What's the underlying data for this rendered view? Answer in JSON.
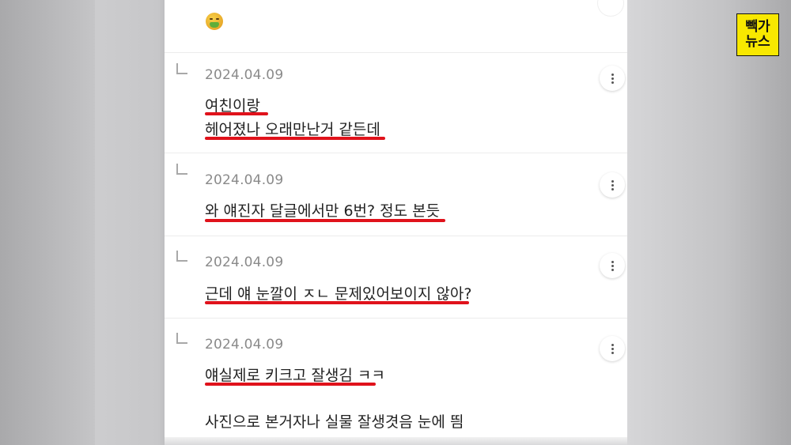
{
  "badge": {
    "line1": "빽가",
    "line2": "뉴스"
  },
  "comments": [
    {
      "date": "2024.04.09",
      "lines": [
        "여친이랑",
        "헤어졌나 오래만난거 같든데"
      ]
    },
    {
      "date": "2024.04.09",
      "lines": [
        "와 얘진자 달글에서만 6번?  정도 본듯"
      ]
    },
    {
      "date": "2024.04.09",
      "lines": [
        "근데 얘 눈깔이 ㅈㄴ 문제있어보이지 않아?"
      ]
    },
    {
      "date": "2024.04.09",
      "lines": [
        "얘실제로 키크고 잘생김 ㅋㅋ",
        "사진으로 본거자나 실물 잘생겻음 눈에 띔"
      ]
    }
  ],
  "icons": {
    "emoji": "nauseated-face-icon",
    "reply": "reply-arrow-icon",
    "more": "more-vertical-icon"
  },
  "colors": {
    "underline": "#e0121b",
    "badge_bg": "#f8e800"
  }
}
